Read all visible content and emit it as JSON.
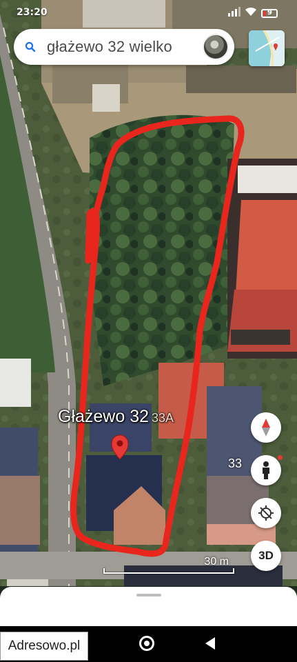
{
  "status_bar": {
    "time": "23:20",
    "battery_level": "9"
  },
  "search": {
    "query": "głażewo 32 wielko"
  },
  "map": {
    "place_label": "Głażewo 32",
    "place_label_suffix": "33A",
    "neighbor_number": "33",
    "scale_label": "30 m",
    "outline_color": "#e8261d",
    "pin_color": "#e53935"
  },
  "controls": {
    "three_d_label": "3D"
  },
  "watermark": {
    "text": "Adresowo.pl"
  }
}
